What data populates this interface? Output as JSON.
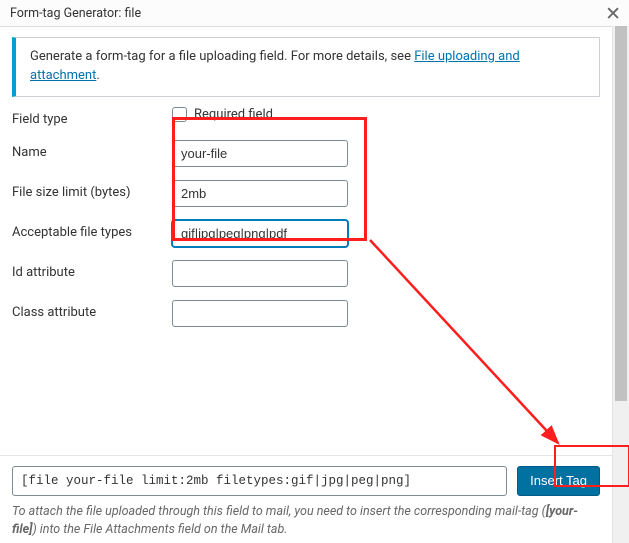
{
  "titlebar": {
    "title": "Form-tag Generator: file"
  },
  "info": {
    "text_before": "Generate a form-tag for a file uploading field. For more details, see ",
    "link_text": "File uploading and attachment",
    "text_after": "."
  },
  "labels": {
    "field_type": "Field type",
    "required": "Required field",
    "name": "Name",
    "file_size": "File size limit (bytes)",
    "acceptable": "Acceptable file types",
    "id_attr": "Id attribute",
    "class_attr": "Class attribute"
  },
  "values": {
    "name": "your-file",
    "file_size": "2mb",
    "acceptable": "gif|jpg|peg|png|pdf",
    "id_attr": "",
    "class_attr": ""
  },
  "bottom": {
    "code": "[file your-file limit:2mb filetypes:gif|jpg|peg|png]",
    "insert_label": "Insert Tag",
    "hint_before": "To attach the file uploaded through this field to mail, you need to insert the corresponding mail-tag (",
    "hint_tag": "[your-file]",
    "hint_after": ") into the File Attachments field on the Mail tab."
  }
}
